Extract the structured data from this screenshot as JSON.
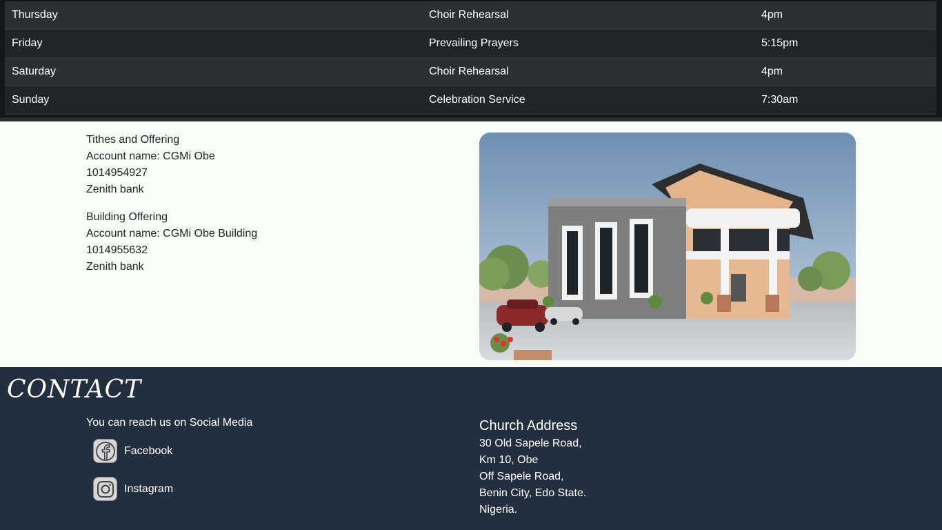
{
  "schedule": {
    "rows": [
      {
        "day": "Thursday",
        "event": "Choir Rehearsal",
        "time": "4pm"
      },
      {
        "day": "Friday",
        "event": "Prevailing Prayers",
        "time": "5:15pm"
      },
      {
        "day": "Saturday",
        "event": "Choir Rehearsal",
        "time": "4pm"
      },
      {
        "day": "Sunday",
        "event": "Celebration Service",
        "time": "7:30am"
      }
    ]
  },
  "offering": {
    "tithes": {
      "title": "Tithes and Offering",
      "account_name": "Account name: CGMi Obe",
      "number": "1014954927",
      "bank": "Zenith bank"
    },
    "building": {
      "title": "Building Offering",
      "account_name": "Account name: CGMi Obe Building",
      "number": "1014955632",
      "bank": "Zenith bank"
    }
  },
  "contact": {
    "title": "CONTACT",
    "reach_text": "You can reach us on Social Media",
    "socials": [
      {
        "label": "Facebook",
        "icon": "facebook-icon"
      },
      {
        "label": "Instagram",
        "icon": "instagram-icon"
      }
    ],
    "address_title": "Church Address",
    "address_lines": [
      "30 Old Sapele Road,",
      "Km 10, Obe",
      "Off Sapele Road,",
      "Benin City, Edo State.",
      "Nigeria."
    ]
  },
  "colors": {
    "table_dark": "#212529",
    "table_striped": "#2c3034",
    "contact_bg": "#222f3e",
    "page_bg": "#f9fdf7"
  }
}
